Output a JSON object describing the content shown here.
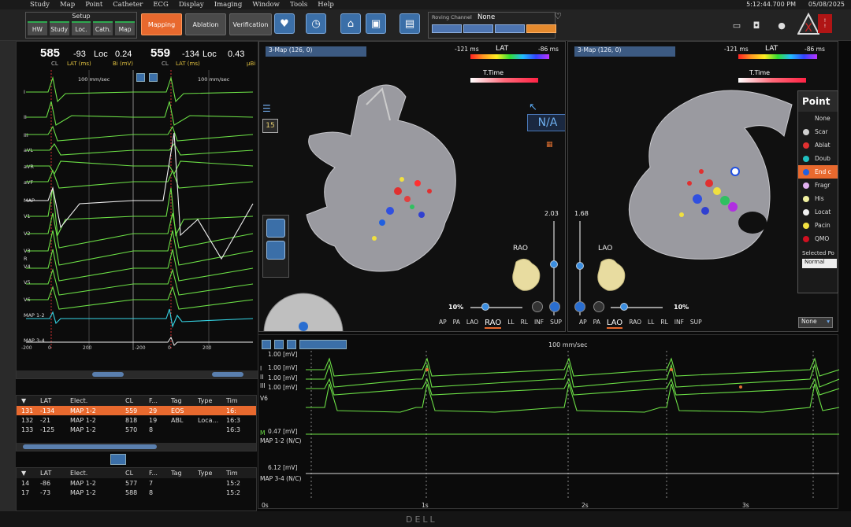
{
  "menu": [
    "Study",
    "Map",
    "Point",
    "Catheter",
    "ECG",
    "Display",
    "Imaging",
    "Window",
    "Tools",
    "Help"
  ],
  "clock": "5:12:44.700 PM",
  "date": "05/08/2025",
  "toolbar": {
    "setup_title": "Setup",
    "setup_tabs": [
      "HW",
      "Study",
      "Loc.",
      "Cath.",
      "Map"
    ],
    "mode_mapping": "Mapping",
    "mode_ablation": "Ablation",
    "mode_verification": "Verification",
    "roving_channel_label": "Roving Channel",
    "roving_channel_value": "None"
  },
  "beat_left": {
    "cl": "585",
    "lat": "-93",
    "loc": "Loc",
    "bi": "0.24",
    "cl_label": "CL",
    "lat_label": "LAT (ms)",
    "bi_label": "Bi (mV)"
  },
  "beat_right": {
    "cl": "559",
    "lat": "-134",
    "loc": "Loc",
    "bi": "0.43",
    "cl_label": "CL",
    "lat_label": "LAT (ms)",
    "bi_label": "µBi"
  },
  "ecg": {
    "speed": "100 mm/sec",
    "leads": [
      "I",
      "II",
      "III",
      "aVL",
      "aVR",
      "aVF",
      "MAP",
      "V1",
      "V2",
      "V3",
      "R",
      "V4",
      "V5",
      "V6",
      "MAP 1-2",
      "MAP 3-4"
    ],
    "axis": [
      "-200",
      "0",
      "200",
      "-200",
      "0",
      "200"
    ]
  },
  "table_top": {
    "headers": [
      "LAT",
      "Elect.",
      "CL",
      "F...",
      "Tag",
      "Type",
      "Tim"
    ],
    "rows": [
      {
        "id": "131",
        "lat": "-134",
        "elect": "MAP 1-2",
        "cl": "559",
        "f": "29",
        "tag": "EOS",
        "type": "",
        "time": "16:"
      },
      {
        "id": "132",
        "lat": "-21",
        "elect": "MAP 1-2",
        "cl": "818",
        "f": "19",
        "tag": "ABL",
        "type": "Loca...",
        "time": "16:3"
      },
      {
        "id": "133",
        "lat": "-125",
        "elect": "MAP 1-2",
        "cl": "570",
        "f": "8",
        "tag": "",
        "type": "",
        "time": "16:3"
      }
    ]
  },
  "table_bottom": {
    "headers": [
      "LAT",
      "Elect.",
      "CL",
      "F...",
      "Tag",
      "Type",
      "Tim"
    ],
    "rows": [
      {
        "id": "14",
        "lat": "-86",
        "elect": "MAP 1-2",
        "cl": "577",
        "f": "7",
        "tag": "",
        "type": "",
        "time": "15:2"
      },
      {
        "id": "17",
        "lat": "-73",
        "elect": "MAP 1-2",
        "cl": "588",
        "f": "8",
        "tag": "",
        "type": "",
        "time": "15:2"
      }
    ]
  },
  "map_left": {
    "title": "3-Map (126, 0)",
    "lat_title": "LAT",
    "lat_min": "-121 ms",
    "lat_max": "-86 ms",
    "ttime": "T.Time",
    "view": "RAO",
    "zoom_value": "2.03",
    "opacity": "10%",
    "counter": "15",
    "na_label": "N/A",
    "view_buttons": [
      "AP",
      "PA",
      "LAO",
      "RAO",
      "LL",
      "RL",
      "INF",
      "SUP"
    ],
    "active_view": "RAO"
  },
  "map_right": {
    "title": "3-Map (126, 0)",
    "lat_title": "LAT",
    "lat_min": "-121 ms",
    "lat_max": "-86 ms",
    "ttime": "T.Time",
    "view": "LAO",
    "zoom_value": "1.68",
    "opacity": "10%",
    "view_buttons": [
      "AP",
      "PA",
      "LAO",
      "RAO",
      "LL",
      "RL",
      "INF",
      "SUP"
    ],
    "active_view": "LAO"
  },
  "point_legend": {
    "title": "Point",
    "items": [
      {
        "label": "None",
        "color": ""
      },
      {
        "label": "Scar",
        "color": "#d0d0d0"
      },
      {
        "label": "Ablat",
        "color": "#e03030"
      },
      {
        "label": "Doub",
        "color": "#20c0c0"
      },
      {
        "label": "End c",
        "color": "#2060e0"
      },
      {
        "label": "Fragr",
        "color": "#e0b0f0"
      },
      {
        "label": "His",
        "color": "#f0f0a0"
      },
      {
        "label": "Locat",
        "color": "#f0f0f0"
      },
      {
        "label": "Pacin",
        "color": "#f0e040"
      },
      {
        "label": "QMO",
        "color": "#d01020"
      }
    ],
    "selected_label": "Selected Po",
    "selected_value": "Normal",
    "none_dropdown": "None"
  },
  "strip": {
    "speed": "100 mm/sec",
    "ch1_scale": "1.00 [mV]",
    "ch2_scale": "1.00 [mV]",
    "ch3_scale": "1.00 [mV]",
    "ch4_scale": "1.00 [mV]",
    "lead_i": "I",
    "lead_ii": "II",
    "lead_iii": "III",
    "lead_v6": "V6",
    "map12_scale": "0.47 [mV]",
    "map12_label": "MAP 1-2 (N/C)",
    "map12_m": "M",
    "map34_scale": "6.12 [mV]",
    "map34_label": "MAP 3-4 (N/C)",
    "time_axis": [
      "0s",
      "1s",
      "2s",
      "3s"
    ]
  },
  "bezel_brand": "DELL"
}
